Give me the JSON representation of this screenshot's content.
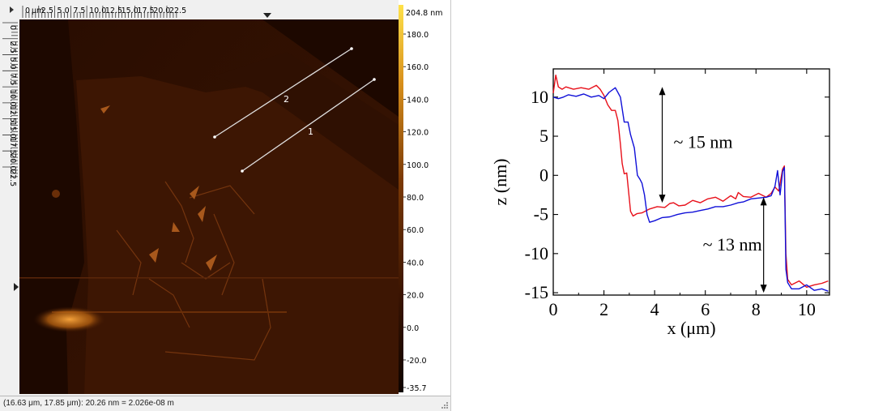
{
  "afm_window": {
    "top_ruler": {
      "unit": "μm",
      "labels": [
        "0",
        "2.5",
        "5.0",
        "7.5",
        "10.0",
        "12.5",
        "15.0",
        "17.5",
        "20.0",
        "22.5"
      ]
    },
    "left_ruler": {
      "labels": [
        "0",
        "2.5",
        "5.0",
        "7.5",
        "10.0",
        "12.5",
        "15.0",
        "17.5",
        "20.0",
        "22.5"
      ]
    },
    "scan_lines": [
      {
        "label": "2"
      },
      {
        "label": "1"
      }
    ],
    "colorbar": {
      "max_label": "204.8 nm",
      "labels": [
        "180.0",
        "160.0",
        "140.0",
        "120.0",
        "100.0",
        "80.0",
        "60.0",
        "40.0",
        "20.0",
        "0.0",
        "-20.0",
        "-35.7"
      ]
    },
    "status_text": "(16.63 μm, 17.85 μm): 20.26 nm = 2.026e-08 m",
    "colors": {
      "background": "#1d0800",
      "flake": "#3b1402",
      "bright": "#f4a13a"
    }
  },
  "chart_data": {
    "type": "line",
    "xlabel": "x (μm)",
    "ylabel": "z (nm)",
    "xlim": [
      0,
      10.9
    ],
    "ylim": [
      -15.3,
      13.6
    ],
    "xticks": [
      "0",
      "2",
      "4",
      "6",
      "8",
      "10"
    ],
    "yticks": [
      "10",
      "5",
      "0",
      "-5",
      "-10",
      "-15"
    ],
    "series": [
      {
        "color": "#e8101a",
        "x": [
          0,
          0.1,
          0.2,
          0.35,
          0.5,
          0.8,
          1.1,
          1.4,
          1.7,
          1.85,
          2.0,
          2.15,
          2.3,
          2.45,
          2.55,
          2.65,
          2.72,
          2.8,
          2.9,
          3.0,
          3.05,
          3.15,
          3.3,
          3.5,
          3.8,
          4.1,
          4.4,
          4.6,
          4.75,
          4.95,
          5.2,
          5.5,
          5.8,
          6.1,
          6.4,
          6.7,
          7.0,
          7.2,
          7.3,
          7.5,
          7.8,
          8.1,
          8.4,
          8.6,
          8.75,
          8.9,
          9.05,
          9.12,
          9.18,
          9.25,
          9.4,
          9.7,
          10.0,
          10.3,
          10.6,
          10.85
        ],
        "y": [
          10.5,
          12.8,
          11.3,
          11.0,
          11.3,
          11.0,
          11.2,
          11.0,
          11.5,
          11.0,
          10.2,
          9.0,
          8.3,
          8.3,
          7.0,
          4.0,
          1.5,
          0.2,
          0.3,
          -3.0,
          -4.6,
          -5.2,
          -4.9,
          -4.8,
          -4.3,
          -4.0,
          -4.1,
          -3.6,
          -3.5,
          -3.9,
          -3.8,
          -3.2,
          -3.5,
          -3.0,
          -2.8,
          -3.3,
          -2.6,
          -3.0,
          -2.2,
          -2.7,
          -2.8,
          -2.3,
          -2.8,
          -2.3,
          -1.5,
          -2.0,
          0.8,
          1.2,
          -10.0,
          -13.3,
          -14.0,
          -13.5,
          -14.3,
          -14.0,
          -13.8,
          -13.5
        ]
      },
      {
        "color": "#1010d8",
        "x": [
          0,
          0.2,
          0.4,
          0.6,
          0.9,
          1.2,
          1.5,
          1.8,
          2.0,
          2.2,
          2.45,
          2.65,
          2.8,
          2.95,
          3.05,
          3.2,
          3.32,
          3.42,
          3.5,
          3.6,
          3.7,
          3.8,
          4.0,
          4.3,
          4.6,
          4.9,
          5.2,
          5.5,
          5.8,
          6.1,
          6.4,
          6.7,
          7.0,
          7.3,
          7.5,
          7.8,
          8.1,
          8.4,
          8.6,
          8.75,
          8.85,
          8.95,
          9.05,
          9.12,
          9.18,
          9.25,
          9.4,
          9.7,
          10.0,
          10.3,
          10.6,
          10.85
        ],
        "y": [
          10.0,
          9.8,
          10.0,
          10.3,
          10.1,
          10.4,
          10.0,
          10.2,
          9.8,
          10.6,
          11.2,
          10.0,
          6.8,
          6.8,
          5.2,
          3.5,
          0.0,
          -0.5,
          -1.0,
          -2.5,
          -5.0,
          -6.0,
          -5.8,
          -5.4,
          -5.3,
          -5.0,
          -4.8,
          -4.7,
          -4.5,
          -4.3,
          -4.0,
          -4.0,
          -3.8,
          -3.5,
          -3.4,
          -3.0,
          -2.9,
          -2.8,
          -2.6,
          -1.4,
          0.6,
          -2.5,
          0.5,
          1.0,
          -12.0,
          -13.7,
          -14.5,
          -14.5,
          -14.0,
          -14.7,
          -14.5,
          -14.8
        ]
      }
    ],
    "annotations": [
      {
        "text": "~ 15 nm",
        "x": 4.3,
        "y_from": 11.3,
        "y_to": -3.5
      },
      {
        "text": "~ 13 nm",
        "x": 8.3,
        "y_from": -2.8,
        "y_to": -15.0
      }
    ]
  }
}
